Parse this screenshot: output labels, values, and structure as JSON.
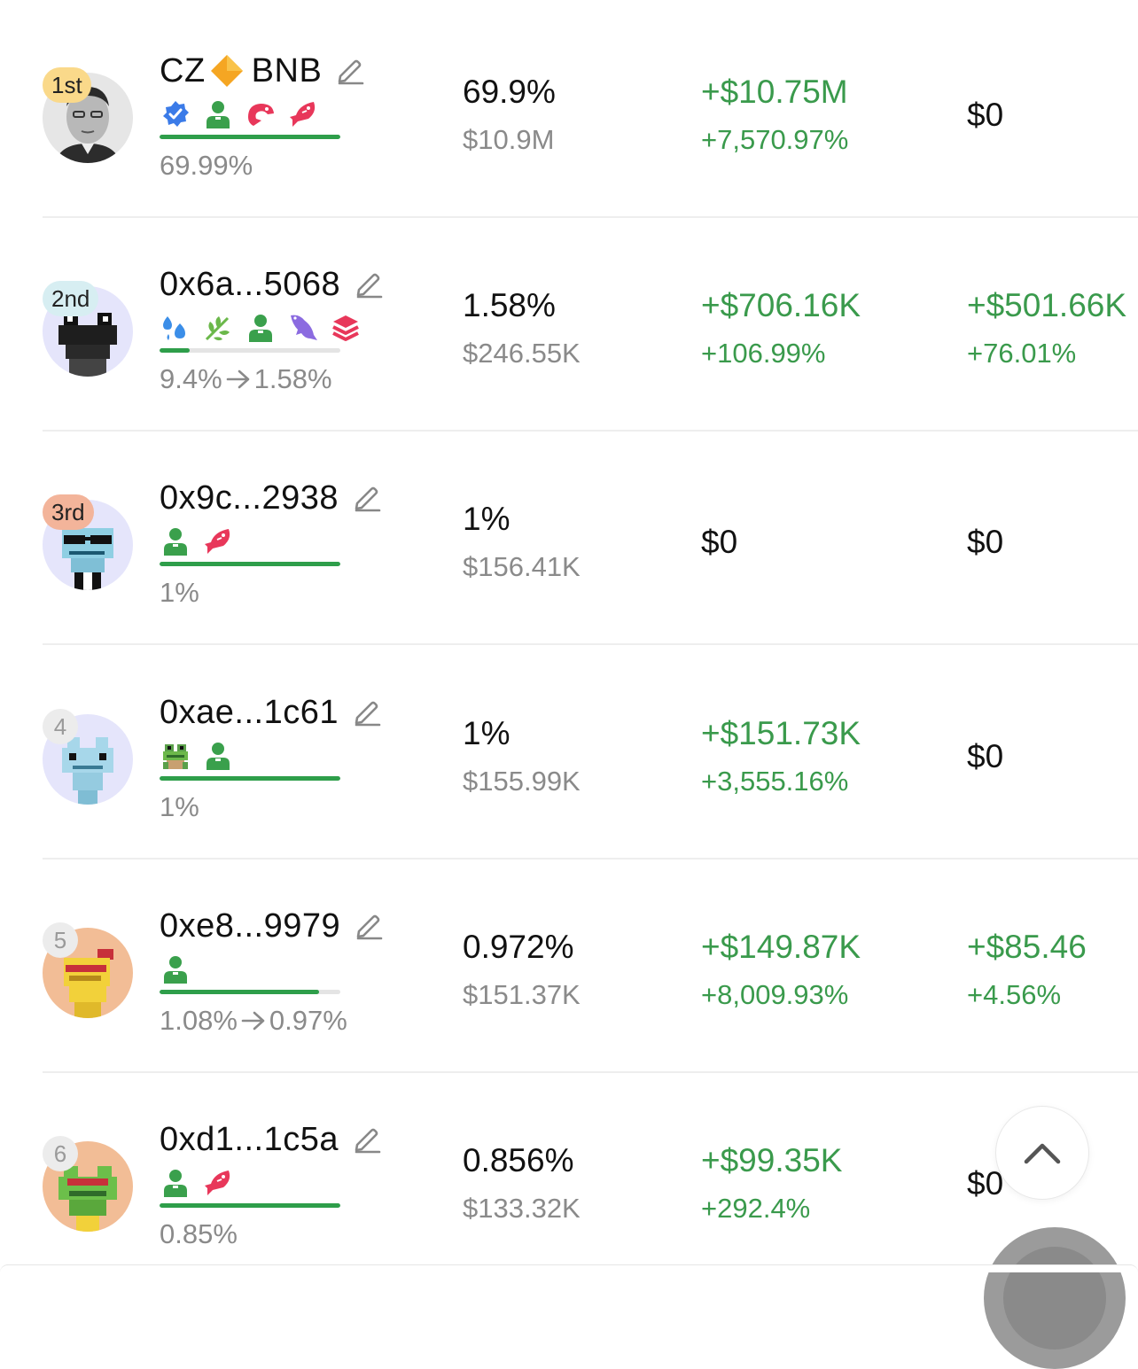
{
  "colors": {
    "positive": "#3a9a4c",
    "progress": "#2e9e4a",
    "muted": "#8a8a8a",
    "badge_gold": "#fad98a",
    "badge_silver": "#d7eef2",
    "badge_bronze": "#f3b49a",
    "badge_default": "#ececec"
  },
  "holders": [
    {
      "rank": "1st",
      "badge_color": "#fad98a",
      "avatar": "photo-avatar",
      "avatar_bg": "#e6e6e6",
      "name": "CZ",
      "chain_icon": "bnb-diamond-icon",
      "chain_label": "BNB",
      "tag_icons": [
        "verified-badge-icon",
        "user-icon",
        "shrimp-icon",
        "fish-icon"
      ],
      "holding_share": 0.9999,
      "holding_text": "69.99%",
      "holding_to": "",
      "percent": "69.9%",
      "value": "$10.9M",
      "pnl": "+$10.75M",
      "pnl_pct": "+7,570.97%",
      "col4": "$0",
      "col4_pct": ""
    },
    {
      "rank": "2nd",
      "badge_color": "#d7eef2",
      "avatar": "pixel-avatar-dark",
      "avatar_bg": "#e5e5fb",
      "name": "0x6a...5068",
      "chain_icon": "",
      "chain_label": "",
      "tag_icons": [
        "droplets-icon",
        "leaf-icon",
        "user-icon",
        "dolphin-icon",
        "layers-icon"
      ],
      "holding_share": 0.168,
      "holding_text": "9.4%",
      "holding_to": "1.58%",
      "percent": "1.58%",
      "value": "$246.55K",
      "pnl": "+$706.16K",
      "pnl_pct": "+106.99%",
      "col4": "+$501.66K",
      "col4_pct": "+76.01%"
    },
    {
      "rank": "3rd",
      "badge_color": "#f3b49a",
      "avatar": "pixel-avatar-blue-shades",
      "avatar_bg": "#e5e5fb",
      "name": "0x9c...2938",
      "chain_icon": "",
      "chain_label": "",
      "tag_icons": [
        "user-icon",
        "fish-icon"
      ],
      "holding_share": 1.0,
      "holding_text": "1%",
      "holding_to": "",
      "percent": "1%",
      "value": "$156.41K",
      "pnl": "",
      "pnl_pct": "",
      "pnl_single": "$0",
      "col4": "$0",
      "col4_pct": ""
    },
    {
      "rank": "4",
      "badge_color": "#ececec",
      "avatar": "pixel-avatar-blue",
      "avatar_bg": "#e5e5fb",
      "name": "0xae...1c61",
      "chain_icon": "",
      "chain_label": "",
      "tag_icons": [
        "frog-icon",
        "user-icon"
      ],
      "holding_share": 1.0,
      "holding_text": "1%",
      "holding_to": "",
      "percent": "1%",
      "value": "$155.99K",
      "pnl": "+$151.73K",
      "pnl_pct": "+3,555.16%",
      "col4": "$0",
      "col4_pct": ""
    },
    {
      "rank": "5",
      "badge_color": "#ececec",
      "avatar": "pixel-avatar-yellow",
      "avatar_bg": "#f2bd96",
      "name": "0xe8...9979",
      "chain_icon": "",
      "chain_label": "",
      "tag_icons": [
        "user-icon"
      ],
      "holding_share": 0.88,
      "holding_text": "1.08%",
      "holding_to": "0.97%",
      "percent": "0.972%",
      "value": "$151.37K",
      "pnl": "+$149.87K",
      "pnl_pct": "+8,009.93%",
      "col4": "+$85.46",
      "col4_pct": "+4.56%"
    },
    {
      "rank": "6",
      "badge_color": "#ececec",
      "avatar": "pixel-avatar-frog",
      "avatar_bg": "#f2bd96",
      "name": "0xd1...1c5a",
      "chain_icon": "",
      "chain_label": "",
      "tag_icons": [
        "user-icon",
        "fish-icon"
      ],
      "holding_share": 1.0,
      "holding_text": "0.85%",
      "holding_to": "",
      "percent": "0.856%",
      "value": "$133.32K",
      "pnl": "+$99.35K",
      "pnl_pct": "+292.4%",
      "col4": "$0",
      "col4_pct": ""
    }
  ],
  "scroll_top": {
    "icon": "chevron-up-icon"
  }
}
